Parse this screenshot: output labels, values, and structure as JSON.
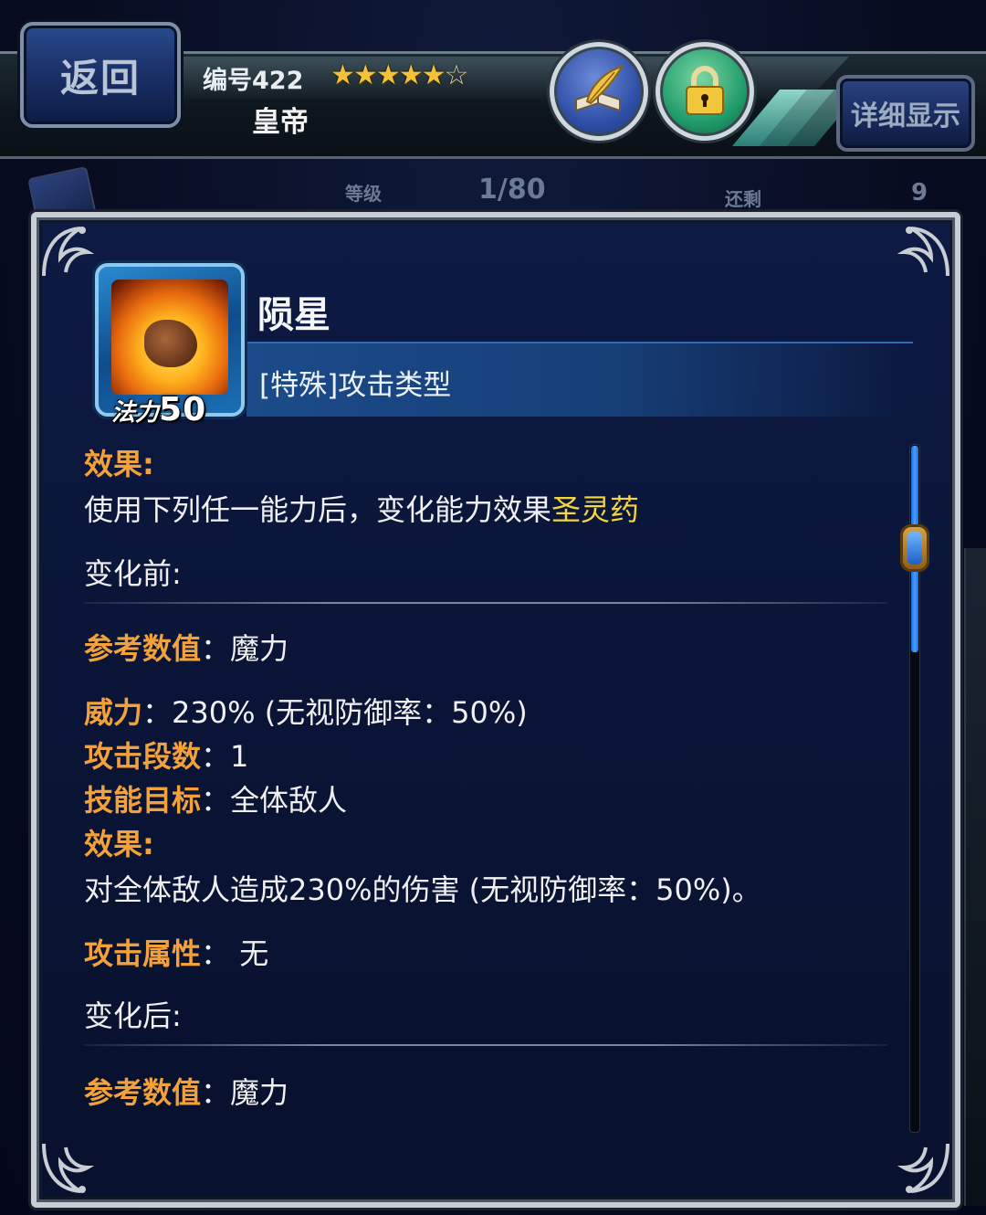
{
  "header": {
    "back_label": "返回",
    "unit_number": "编号422",
    "stars_filled": 5,
    "stars_total": 6,
    "unit_name": "皇帝",
    "detail_label": "详细显示",
    "notes_icon": "quill-book-icon",
    "lock_icon": "padlock-icon"
  },
  "background_stats": {
    "level_label": "等级",
    "level_value": "1/80",
    "remaining_label": "还剩",
    "remaining_value": "9"
  },
  "skill": {
    "name": "陨星",
    "type": "[特殊]攻击类型",
    "mp_label": "法力",
    "mp_value": "50",
    "icon": "meteor-icon"
  },
  "description": {
    "effect_label": "效果",
    "intro_text": "使用下列任一能力后，变化能力效果",
    "intro_highlight": "圣灵药",
    "before_label": "变化前",
    "before": {
      "ref_label": "参考数值",
      "ref_value": "魔力",
      "power_label": "威力",
      "power_value": "230% (无视防御率：50%)",
      "hits_label": "攻击段数",
      "hits_value": "1",
      "target_label": "技能目标",
      "target_value": "全体敌人",
      "effect_label": "效果",
      "effect_text": "对全体敌人造成230%的伤害 (无视防御率：50%)。",
      "element_label": "攻击属性",
      "element_value": "无"
    },
    "after_label": "变化后",
    "after": {
      "ref_label": "参考数值",
      "ref_value": "魔力"
    }
  },
  "colors": {
    "keyword": "#f3a13a",
    "highlight": "#f5d53a",
    "panel_bg": "#0a1538",
    "scroll_fill": "#48a0ff"
  }
}
